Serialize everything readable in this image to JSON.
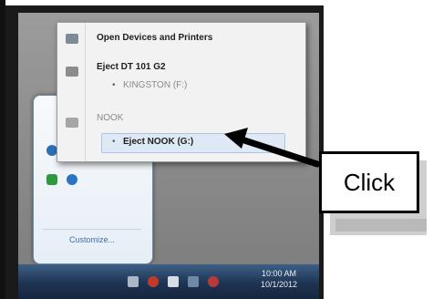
{
  "context_menu": {
    "items": [
      {
        "label": "Open Devices and Printers",
        "icon": "devices-printers-icon",
        "style": "bold"
      },
      {
        "label": "Eject DT 101 G2",
        "icon": "usb-drive-icon",
        "style": "bold"
      },
      {
        "label": "KINGSTON (F:)",
        "style": "sub-dim"
      },
      {
        "label": "NOOK",
        "icon": "nook-drive-icon",
        "style": "dim"
      },
      {
        "label": "Eject NOOK (G:)",
        "style": "sub-highlighted"
      }
    ]
  },
  "tray_overflow": {
    "customize_label": "Customize..."
  },
  "taskbar": {
    "clock_time": "10:00 AM",
    "clock_date": "10/1/2012",
    "icons": [
      "notification-flag-icon",
      "volume-icon",
      "network-signal-icon",
      "safely-remove-hardware-icon"
    ]
  },
  "annotation": {
    "label": "Click",
    "arrow_color": "#000000"
  }
}
